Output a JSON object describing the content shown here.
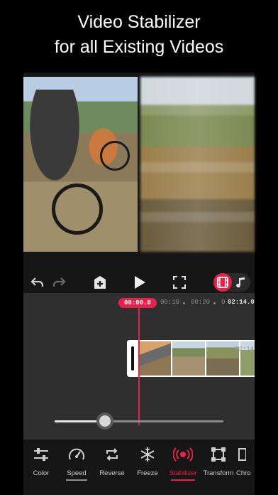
{
  "headline": {
    "line1": "Video Stabilizer",
    "line2": "for all Existing Videos"
  },
  "colors": {
    "accent": "#e8214b",
    "background": "#000000",
    "timeline": "#2f2f2f"
  },
  "toolbar": {
    "icons": [
      "undo-icon",
      "redo-icon",
      "add-clip-icon",
      "play-icon",
      "fullscreen-icon",
      "video-track-icon",
      "music-track-icon"
    ]
  },
  "timeline": {
    "current_time": "00:00.0",
    "ticks": [
      "00:10",
      "00:20",
      "0",
      "02:14.0"
    ],
    "clip_duration": "02:14",
    "zoom_level": 0.3
  },
  "tools": [
    {
      "label": "Color",
      "icon": "adjust-sliders-icon"
    },
    {
      "label": "Speed",
      "icon": "speedometer-icon"
    },
    {
      "label": "Reverse",
      "icon": "reverse-icon"
    },
    {
      "label": "Freeze",
      "icon": "snowflake-icon"
    },
    {
      "label": "Stabilizer",
      "icon": "stabilizer-icon"
    },
    {
      "label": "Transform",
      "icon": "transform-icon"
    },
    {
      "label": "Chro",
      "icon": "chroma-icon"
    }
  ]
}
